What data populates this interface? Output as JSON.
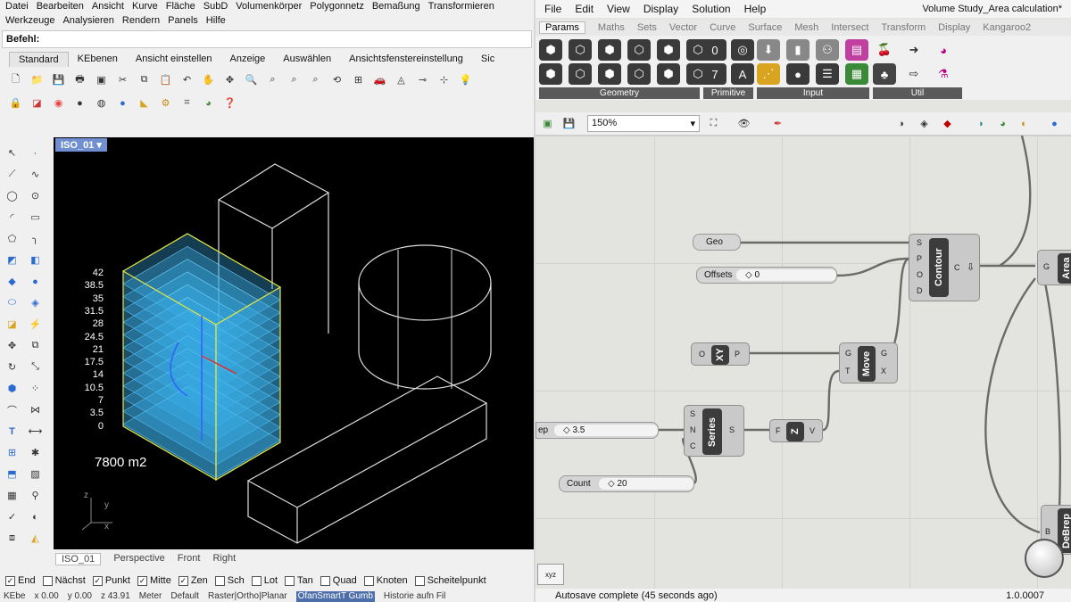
{
  "rhino": {
    "menu": [
      "Datei",
      "Bearbeiten",
      "Ansicht",
      "Kurve",
      "Fläche",
      "SubD",
      "Volumenkörper",
      "Polygonnetz",
      "Bemaßung",
      "Transformieren",
      "Werkzeuge",
      "Analysieren",
      "Rendern",
      "Panels",
      "Hilfe"
    ],
    "command_label": "Befehl:",
    "tabs": [
      "Standard",
      "KEbenen",
      "Ansicht einstellen",
      "Anzeige",
      "Auswählen",
      "Ansichtsfenstereinstellung",
      "Sic"
    ],
    "viewport_label": "ISO_01",
    "level_labels": [
      "42",
      "38.5",
      "35",
      "31.5",
      "28",
      "24.5",
      "21",
      "17.5",
      "14",
      "10.5",
      "7",
      "3.5",
      "0"
    ],
    "area_label": "7800 m2",
    "axis_y": "y",
    "axis_x": "x",
    "axis_z": "z",
    "viewport_tabs": [
      "ISO_01",
      "Perspective",
      "Front",
      "Right"
    ],
    "osnaps": [
      {
        "label": "End",
        "checked": true
      },
      {
        "label": "Nächst",
        "checked": false
      },
      {
        "label": "Punkt",
        "checked": true
      },
      {
        "label": "Mitte",
        "checked": true
      },
      {
        "label": "Zen",
        "checked": true
      },
      {
        "label": "Sch",
        "checked": false
      },
      {
        "label": "Lot",
        "checked": false
      },
      {
        "label": "Tan",
        "checked": false
      },
      {
        "label": "Quad",
        "checked": false
      },
      {
        "label": "Knoten",
        "checked": false
      },
      {
        "label": "Scheitelpunkt",
        "checked": false
      }
    ],
    "status": {
      "layer": "KEbe",
      "x": "x 0.00",
      "y": "y 0.00",
      "z": "z 43.91",
      "units": "Meter",
      "default": "Default",
      "modes": "Raster|Ortho|Planar",
      "osnap": "OfanSmartT Gumb",
      "history": "Historie aufn Fil"
    }
  },
  "grasshopper": {
    "menu": [
      "File",
      "Edit",
      "View",
      "Display",
      "Solution",
      "Help"
    ],
    "title": "Volume Study_Area calculation*",
    "tabs": [
      "Params",
      "Maths",
      "Sets",
      "Vector",
      "Curve",
      "Surface",
      "Mesh",
      "Intersect",
      "Transform",
      "Display",
      "Kangaroo2"
    ],
    "ribbon_groups": [
      "Geometry",
      "Primitive",
      "Input",
      "Util"
    ],
    "zoom": "150%",
    "components": {
      "geo": "Geo",
      "offsets": "Offsets",
      "offsets_value": "◇ 0",
      "contour": "Contour",
      "xy": "XY",
      "move": "Move",
      "series": "Series",
      "z": "Z",
      "step_value": "◇ 3.5",
      "step_label": "ep",
      "count": "Count",
      "count_value": "◇ 20",
      "area": "Area",
      "debrep": "DeBrep"
    },
    "status_text": "Autosave complete (45 seconds ago)",
    "version": "1.0.0007"
  },
  "colors": {
    "viewport_bg": "#000000",
    "volume_fill": "#3aaee8",
    "selection": "#e8e840",
    "canvas_bg": "#e3e3df",
    "component_core": "#3c3c3c"
  }
}
